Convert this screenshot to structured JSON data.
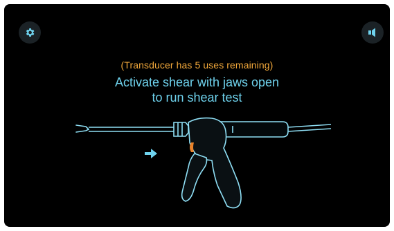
{
  "header": {
    "settings_icon": "gear-icon",
    "volume_icon": "speaker-icon"
  },
  "status": {
    "text": "(Transducer has 5 uses remaining)",
    "color": "#f3a93b"
  },
  "instruction": {
    "line1": "Activate shear with jaws open",
    "line2": "to run shear test",
    "color": "#6fd3ee"
  },
  "illustration": {
    "subject": "ultrasonic shears handpiece",
    "indicator_icon": "arrow-right-icon",
    "accent_color": "#e8822a",
    "outline_color": "#8fdff5"
  }
}
